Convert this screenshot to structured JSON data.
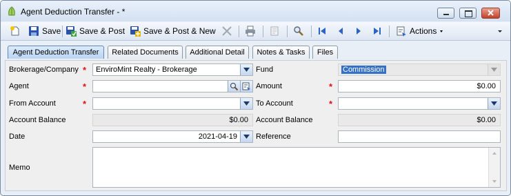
{
  "window": {
    "title": "Agent Deduction Transfer - *"
  },
  "toolbar": {
    "save": "Save",
    "save_post": "Save & Post",
    "save_post_new": "Save & Post & New",
    "actions": "Actions"
  },
  "tabs": [
    {
      "label": "Agent Deduction Transfer",
      "active": true
    },
    {
      "label": "Related Documents"
    },
    {
      "label": "Additional Detail"
    },
    {
      "label": "Notes & Tasks"
    },
    {
      "label": "Files"
    }
  ],
  "form": {
    "brokerage": {
      "label": "Brokerage/Company",
      "value": "EnviroMint Realty - Brokerage"
    },
    "fund": {
      "label": "Fund",
      "value": "Commission"
    },
    "agent": {
      "label": "Agent",
      "value": ""
    },
    "amount": {
      "label": "Amount",
      "value": "$0.00"
    },
    "from_account": {
      "label": "From Account",
      "value": ""
    },
    "to_account": {
      "label": "To Account",
      "value": ""
    },
    "from_balance": {
      "label": "Account Balance",
      "value": "$0.00"
    },
    "to_balance": {
      "label": "Account Balance",
      "value": "$0.00"
    },
    "date": {
      "label": "Date",
      "value": "2021-04-19"
    },
    "reference": {
      "label": "Reference",
      "value": ""
    },
    "memo": {
      "label": "Memo",
      "value": ""
    },
    "required_mark": "*"
  },
  "colors": {
    "accent": "#3471c4",
    "required": "#e01010",
    "title_bg": "#d4e1f1"
  }
}
